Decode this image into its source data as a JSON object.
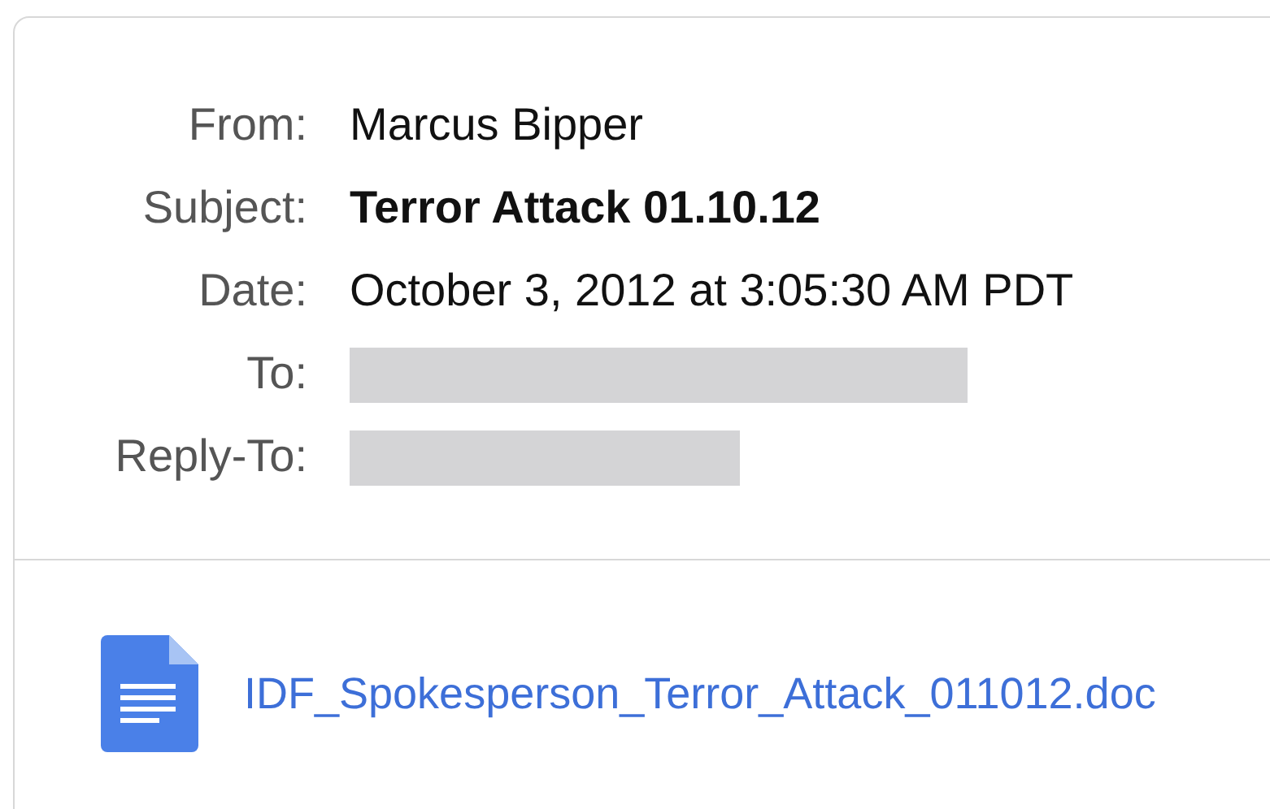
{
  "header_fields": [
    {
      "label": "From:",
      "kind": "text",
      "value": "Marcus Bipper"
    },
    {
      "label": "Subject:",
      "kind": "bold",
      "value": "Terror Attack 01.10.12"
    },
    {
      "label": "Date:",
      "kind": "text",
      "value": "October 3, 2012 at 3:05:30 AM PDT"
    },
    {
      "label": "To:",
      "kind": "redacted"
    },
    {
      "label": "Reply-To:",
      "kind": "redacted"
    }
  ],
  "attachment": {
    "filename": "IDF_Spokesperson_Terror_Attack_011012.doc"
  }
}
